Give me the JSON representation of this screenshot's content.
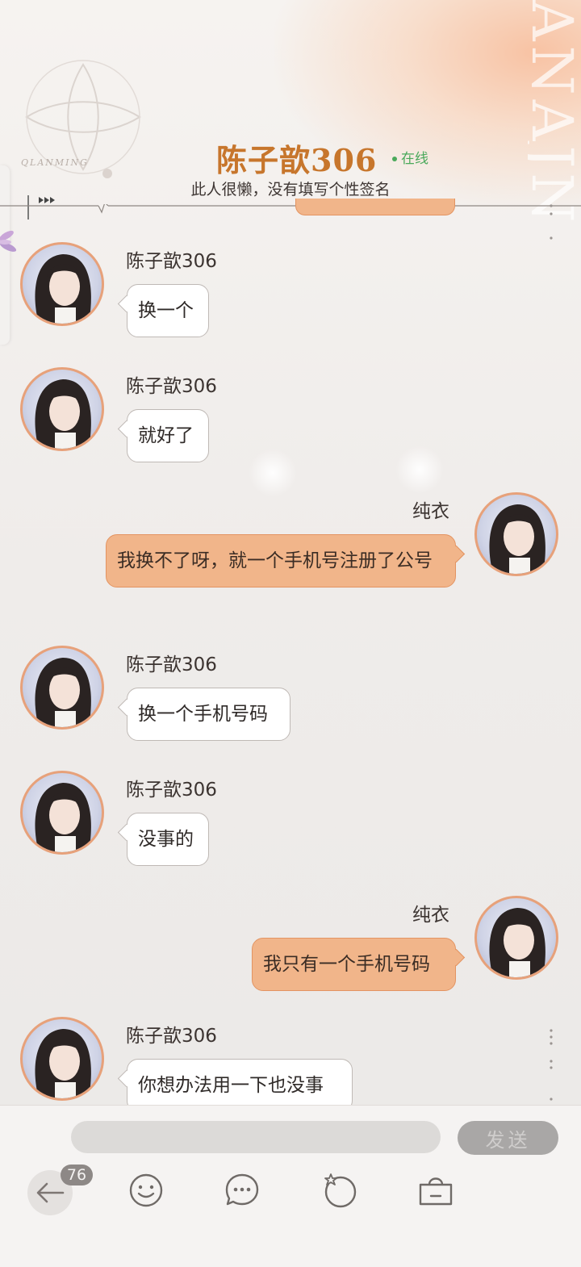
{
  "header": {
    "title": "陈子歆306",
    "status": "在线",
    "signature": "此人很懒，没有填写个性签名",
    "brand": "QLANMING"
  },
  "messages": [
    {
      "side": "left",
      "sender": "陈子歆306",
      "text": "换一个"
    },
    {
      "side": "left",
      "sender": "陈子歆306",
      "text": "就好了"
    },
    {
      "side": "right",
      "sender": "纯衣",
      "text": "我换不了呀，就一个手机号注册了公号"
    },
    {
      "side": "left",
      "sender": "陈子歆306",
      "text": "换一个手机号码"
    },
    {
      "side": "left",
      "sender": "陈子歆306",
      "text": "没事的"
    },
    {
      "side": "right",
      "sender": "纯衣",
      "text": "我只有一个手机号码"
    },
    {
      "side": "left",
      "sender": "陈子歆306",
      "text": "你想办法用一下也没事"
    }
  ],
  "composer": {
    "input_value": "",
    "send_label": "发送"
  },
  "toolbar": {
    "unread_count": "76",
    "icons": [
      "back-arrow-icon",
      "emoji-icon",
      "quick-reply-icon",
      "star-ring-icon",
      "shopping-bag-icon"
    ]
  },
  "colors": {
    "accent": "#c7762c",
    "online": "#4aa95b",
    "own_bubble": "#f1b58a",
    "avatar_ring": "#e7a17a"
  }
}
